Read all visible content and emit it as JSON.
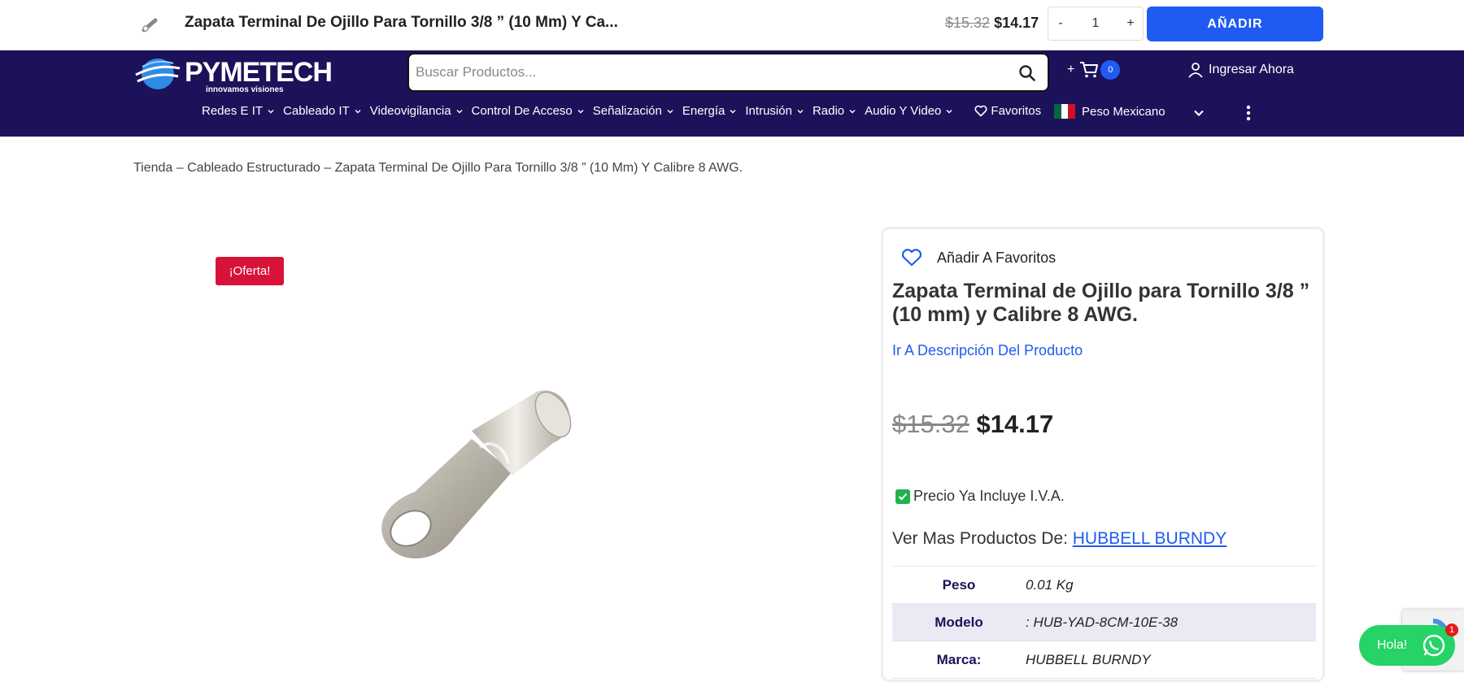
{
  "sticky": {
    "title": "Zapata Terminal De Ojillo Para Tornillo 3/8 ” (10 Mm) Y Ca...",
    "price_old": "$15.32",
    "price_new": "$14.17",
    "qty_minus": "-",
    "qty_value": "1",
    "qty_plus": "+",
    "add_label": "AÑADIR"
  },
  "header": {
    "logo_text": "PYMETECH",
    "logo_sub": "innovamos visiones",
    "search_placeholder": "Buscar Productos...",
    "cart_plus": "+",
    "cart_count": "0",
    "login_label": "Ingresar Ahora",
    "nav": [
      {
        "label": "Redes E IT"
      },
      {
        "label": "Cableado IT"
      },
      {
        "label": "Videovigilancia"
      },
      {
        "label": "Control De Acceso"
      },
      {
        "label": "Señalización"
      },
      {
        "label": "Energía"
      },
      {
        "label": "Intrusión"
      },
      {
        "label": "Radio"
      },
      {
        "label": "Audio Y Video"
      }
    ],
    "favorites_label": "Favoritos",
    "currency_label": "Peso Mexicano",
    "brand_color": "#1c1259",
    "accent_color": "#1f5bf2"
  },
  "breadcrumb": {
    "home": "Tienda",
    "sep": " – ",
    "category": "Cableado Estructurado",
    "current": "Zapata Terminal De Ojillo Para Tornillo 3/8 ” (10 Mm) Y Calibre 8 AWG."
  },
  "gallery": {
    "sale_badge": "¡Oferta!",
    "sale_color": "#d8133a"
  },
  "product": {
    "add_favorite_label": "Añadir A Favoritos",
    "title": "Zapata Terminal de Ojillo para Tornillo 3/8 ” (10 mm) y Calibre 8 AWG.",
    "description_link": "Ir A Descripción Del Producto",
    "price_old": "$15.32",
    "price_new": "$14.17",
    "iva_note": "Precio Ya Incluye I.V.A.",
    "more_by_label": "Ver Mas Productos De: ",
    "brand_link": "HUBBELL BURNDY",
    "specs": [
      {
        "label": "Peso",
        "value": "0.01 Kg"
      },
      {
        "label": "Modelo",
        "value": ": HUB-YAD-8CM-10E-38"
      },
      {
        "label": "Marca:",
        "value": "HUBBELL BURNDY"
      }
    ]
  },
  "whatsapp": {
    "label": "Hola!",
    "badge": "1"
  }
}
